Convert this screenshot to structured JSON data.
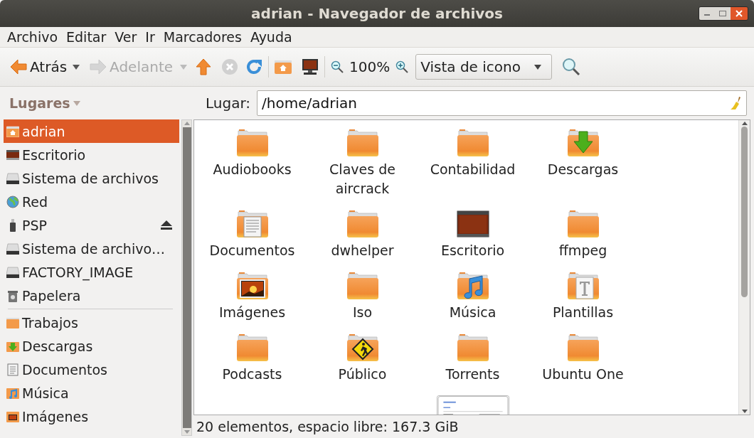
{
  "window": {
    "title": "adrian - Navegador de archivos"
  },
  "menu": [
    {
      "label": "Archivo"
    },
    {
      "label": "Editar"
    },
    {
      "label": "Ver"
    },
    {
      "label": "Ir"
    },
    {
      "label": "Marcadores"
    },
    {
      "label": "Ayuda"
    }
  ],
  "toolbar": {
    "back": {
      "label": "Atrás",
      "disabled": false
    },
    "forward": {
      "label": "Adelante",
      "disabled": true
    },
    "stop": {
      "disabled": true
    },
    "zoom": "100%",
    "view": {
      "value": "Vista de icono"
    }
  },
  "sidebar": {
    "header": "Lugares",
    "groups": [
      {
        "items": [
          {
            "label": "adrian",
            "kind": "home",
            "selected": true,
            "eject": false
          },
          {
            "label": "Escritorio",
            "kind": "desktop",
            "selected": false,
            "eject": false
          },
          {
            "label": "Sistema de archivos",
            "kind": "drive",
            "selected": false,
            "eject": false
          },
          {
            "label": "Red",
            "kind": "network",
            "selected": false,
            "eject": false
          },
          {
            "label": "PSP",
            "kind": "usb",
            "selected": false,
            "eject": true
          },
          {
            "label": "Sistema de archivo…",
            "kind": "drive",
            "selected": false,
            "eject": false
          },
          {
            "label": "FACTORY_IMAGE",
            "kind": "drive",
            "selected": false,
            "eject": false
          },
          {
            "label": "Papelera",
            "kind": "trash",
            "selected": false,
            "eject": false
          }
        ]
      },
      {
        "items": [
          {
            "label": "Trabajos",
            "kind": "folder",
            "selected": false,
            "eject": false
          },
          {
            "label": "Descargas",
            "kind": "download",
            "selected": false,
            "eject": false
          },
          {
            "label": "Documentos",
            "kind": "documents",
            "selected": false,
            "eject": false
          },
          {
            "label": "Música",
            "kind": "music",
            "selected": false,
            "eject": false
          },
          {
            "label": "Imágenes",
            "kind": "pictures",
            "selected": false,
            "eject": false
          }
        ]
      }
    ]
  },
  "location": {
    "label": "Lugar:",
    "value": "/home/adrian"
  },
  "files": [
    {
      "name": "Audiobooks",
      "kind": "folder"
    },
    {
      "name": "Claves de aircrack",
      "kind": "folder"
    },
    {
      "name": "Contabilidad",
      "kind": "folder"
    },
    {
      "name": "Descargas",
      "kind": "download"
    },
    {
      "name": "Documentos",
      "kind": "documents"
    },
    {
      "name": "dwhelper",
      "kind": "folder"
    },
    {
      "name": "Escritorio",
      "kind": "desktop"
    },
    {
      "name": "ffmpeg",
      "kind": "folder"
    },
    {
      "name": "Imágenes",
      "kind": "pictures"
    },
    {
      "name": "Iso",
      "kind": "folder"
    },
    {
      "name": "Música",
      "kind": "music"
    },
    {
      "name": "Plantillas",
      "kind": "templates"
    },
    {
      "name": "Podcasts",
      "kind": "folder"
    },
    {
      "name": "Público",
      "kind": "public"
    },
    {
      "name": "Torrents",
      "kind": "folder"
    },
    {
      "name": "Ubuntu One",
      "kind": "folder"
    },
    {
      "kind": "document-thumbnail"
    }
  ],
  "status_bar": "20 elementos, espacio libre: 167.3 GiB"
}
